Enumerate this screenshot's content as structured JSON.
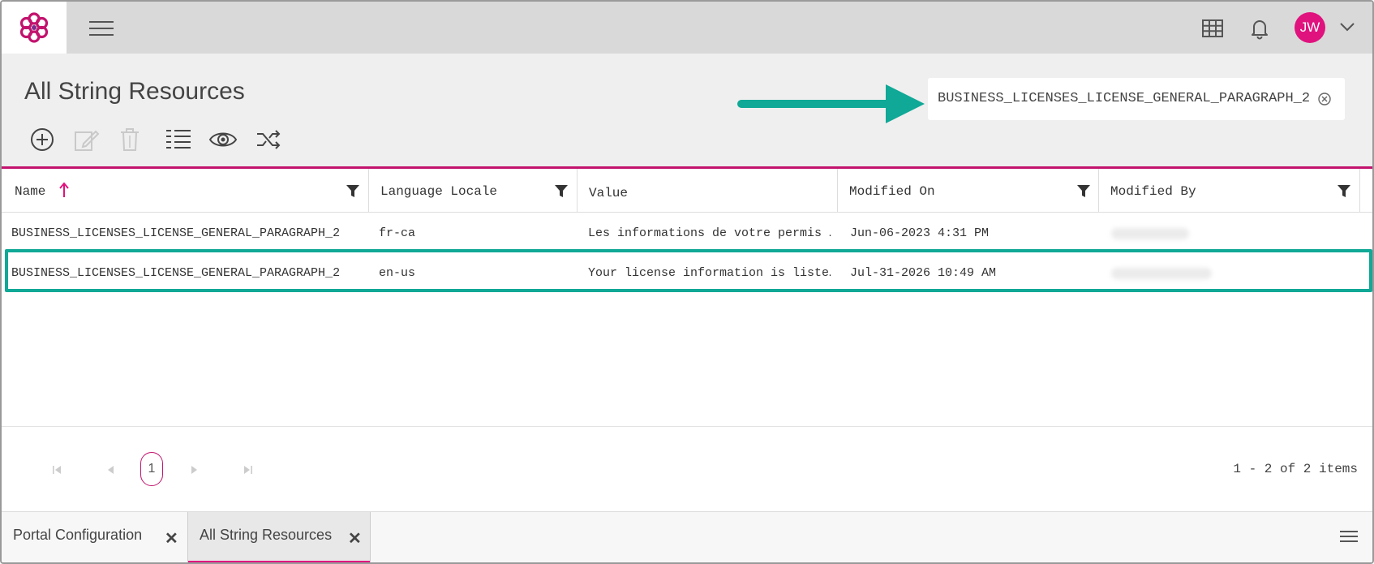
{
  "topbar": {
    "user_initials": "JW"
  },
  "page": {
    "title": "All String Resources"
  },
  "search": {
    "value": "BUSINESS_LICENSES_LICENSE_GENERAL_PARAGRAPH_2"
  },
  "grid": {
    "columns": [
      "Name",
      "Language Locale",
      "Value",
      "Modified On",
      "Modified By"
    ],
    "rows": [
      {
        "name": "BUSINESS_LICENSES_LICENSE_GENERAL_PARAGRAPH_2",
        "locale": "fr-ca",
        "value": "Les informations de votre permis …",
        "modified_on": "Jun-06-2023 4:31 PM"
      },
      {
        "name": "BUSINESS_LICENSES_LICENSE_GENERAL_PARAGRAPH_2",
        "locale": "en-us",
        "value": "Your license information is liste…",
        "modified_on": "Jul-31-2026 10:49 AM"
      }
    ]
  },
  "pager": {
    "current_page": "1",
    "info": "1 - 2 of 2 items"
  },
  "tabs": [
    {
      "label": "Portal Configuration",
      "close": "✕"
    },
    {
      "label": "All String Resources",
      "close": "✕"
    }
  ],
  "colors": {
    "brand_pink": "#e0127e",
    "highlight_teal": "#10a896"
  }
}
